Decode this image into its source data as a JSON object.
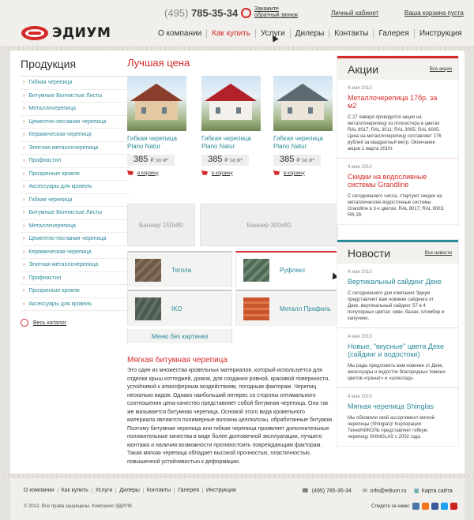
{
  "header": {
    "logo": "ЭДИУМ",
    "phone_code": "(495)",
    "phone_number": "785-35-34",
    "callback_line1": "Закажите",
    "callback_line2": "обратный звонок",
    "account_link": "Личный кабинет",
    "cart_link": "Ваша корзина пуста",
    "nav": [
      "О компании",
      "Как купить",
      "Услуги",
      "Дилеры",
      "Контакты",
      "Галерея",
      "Инструкция"
    ]
  },
  "sidebar": {
    "title": "Продукция",
    "items": [
      "Гибкая черепица",
      "Битумные Волнистые Листы",
      "Металлочерепица",
      "Цементно-песчаная черепица",
      "Керамическая черепица",
      "Элитная металлочерепица",
      "Профнастил",
      "Прозрачные кровли",
      "Аксессуары для кровель",
      "Гибкая черепица",
      "Битумные Волнистые Листы",
      "Металлочерепица",
      "Цементно-песчаная черепица",
      "Керамическая черепица",
      "Элитная металлочерепица",
      "Профнастил",
      "Прозрачные кровли",
      "Аксессуары для кровель"
    ],
    "catalog_link": "Весь каталог"
  },
  "main": {
    "title": "Лучшая цена",
    "products": [
      {
        "name_line1": "Гибкая черепица",
        "name_line2": "Plano Natur",
        "price": "385",
        "unit": "₽ за м²",
        "cart": "в корзину"
      },
      {
        "name_line1": "Гибкая черепица",
        "name_line2": "Plano Natur",
        "price": "385",
        "unit": "₽ за м²",
        "cart": "в корзину"
      },
      {
        "name_line1": "Гибкая черепица",
        "name_line2": "Plano Natur",
        "price": "385",
        "unit": "₽ за м²",
        "cart": "в корзину"
      }
    ],
    "banner_small": "Баннер 150x80",
    "banner_large": "Баннер 300x80",
    "tiles": [
      "Тегола",
      "Руфлекс",
      "IKO",
      "Металл Профиль"
    ],
    "menu_no_pictures": "Меню без картинки",
    "article_title": "Мягкая битумная черепица",
    "article_text": "Это один из множества кровельных материалов, который используется для отделки крыш коттеджей, домов, для создания ровной, красивой поверхности, устойчивой к атмосферным воздействиям, погодным факторам. Черепиц несколько видов. Однако наибольший интерес со стороны оптимального соотношения цена-качество представляет собой битумная черепица. Она так же мазывается битумная черепица. Основой этого вида кровельного материала являются полимерные волокна целлюлозы, обработанные битумом. Поэтому битумная черепица или гибкая черепица проявляет дополнительные положительные качества в виде более долговечной эксплуатации, лучшего монтажа и наличия возможности противостоять повреждающим факторам. Такая мягкая черепица обладает высокой прочностью, пластичностью, повышенной устойчивостью к деформации."
  },
  "promos": {
    "title": "Акции",
    "all_link": "Все акции",
    "items": [
      {
        "date": "4 мая 2010",
        "title": "Металлочерепица 17бр. за м2",
        "body": "С 27 января проводится акция на металлочерепицу из полиэстера в цветах RAL 8017; RAL 3011; RAL 3005; RAL 6005. Цена на металлочерепицу составляет 176 рублей за квадратный метр. Окончание акции 1 марта 2010г."
      },
      {
        "date": "4 мая 2010",
        "title": "Скидки на водосливные системы Grandline",
        "body": "С сегодняшнего числа, стартуют скидки на металлические водосточные системы Grandline в 3-х цветах. RAL 8017; RAL 9003; RR 29."
      }
    ]
  },
  "news": {
    "title": "Новости",
    "all_link": "Все новости",
    "items": [
      {
        "date": "4 мая 2010",
        "title": "Вертикальный сайдинг Деке",
        "body": "С сегодняшнего дня компания Эдиум представляет вам новинки сайдинга от Деке, вертикальный сайдинг S7 в 4 популярных цветах: киви, банан, пломбир и капучино."
      },
      {
        "date": "4 мая 2010",
        "title": "Новые, \"вкусные\" цвета Деке (сайдинг и водостоки)",
        "body": "Мы рады предложить вам новинки от Деке, аксессуары и водосток благородных темных цветов «гранат» и «шоколад»"
      },
      {
        "date": "4 мая 2010",
        "title": "Мягкая черепица Shinglas",
        "body": "Мы обновили свой ассортимент мягкой черепицы (Shinglas)! Корпорация ТехноНИКОЛЬ представляет гибкую черепицу SHINGLAS с 2002 года."
      }
    ]
  },
  "footer": {
    "nav": [
      "О компании",
      "Как купить",
      "Услуги",
      "Дилеры",
      "Контакты",
      "Галерея",
      "Инструкция"
    ],
    "phone": "(495) 785-35-34",
    "email": "info@edium.ru",
    "map_link": "Карта сайта",
    "copyright": "© 2012. Все права защищены. Компания ЭДИУМ.",
    "follow": "Следите за нами:"
  },
  "colors": {
    "accent": "#d42a2a",
    "link": "#2a8a98",
    "background": "#e5e3df"
  }
}
